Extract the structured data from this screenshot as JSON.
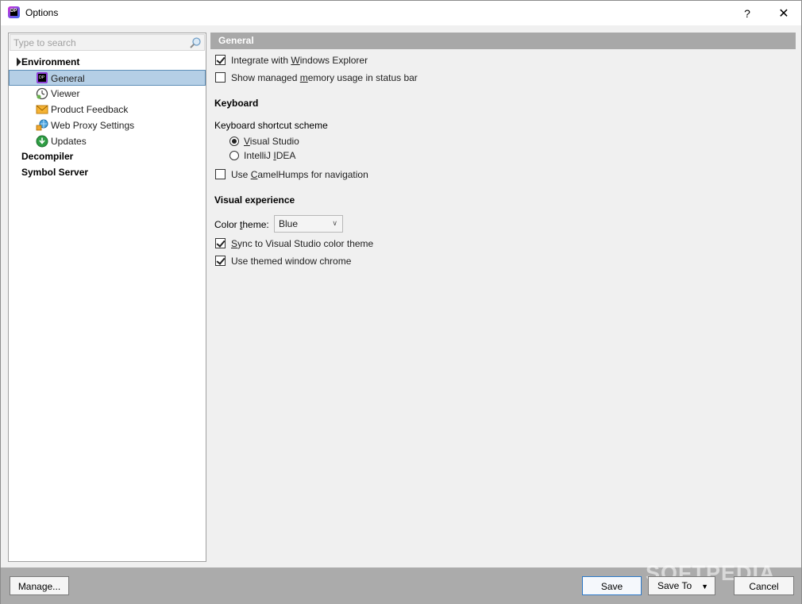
{
  "window": {
    "title": "Options",
    "help_label": "?",
    "close_label": "✕"
  },
  "app_icon_text": "DP",
  "search": {
    "placeholder": "Type to search"
  },
  "tree": {
    "environment": "Environment",
    "children": [
      "General",
      "Viewer",
      "Product Feedback",
      "Web Proxy Settings",
      "Updates"
    ],
    "decompiler": "Decompiler",
    "symbol_server": "Symbol Server",
    "selected": "General"
  },
  "general": {
    "header": "General",
    "integrate_explorer": {
      "pre": "Integrate with ",
      "accel": "W",
      "post": "indows Explorer",
      "checked": true
    },
    "show_memory": {
      "pre": "Show managed ",
      "accel": "m",
      "post": "emory usage in status bar",
      "checked": false
    },
    "keyboard_heading": "Keyboard",
    "shortcut_scheme_label": "Keyboard shortcut scheme",
    "scheme_vs": {
      "pre": "",
      "accel": "V",
      "post": "isual Studio",
      "selected": true
    },
    "scheme_idea": {
      "pre": "IntelliJ ",
      "accel": "I",
      "post": "DEA",
      "selected": false
    },
    "camelhumps": {
      "pre": "Use ",
      "accel": "C",
      "post": "amelHumps for navigation",
      "checked": false
    },
    "visual_heading": "Visual experience",
    "color_theme_label": {
      "pre": "Color ",
      "accel": "t",
      "post": "heme:"
    },
    "color_theme_value": "Blue",
    "sync_vs": {
      "pre": "",
      "accel": "S",
      "post": "ync to Visual Studio color theme",
      "checked": true
    },
    "themed_chrome": {
      "pre": "Use themed window chrome",
      "accel": "",
      "post": "",
      "checked": true
    }
  },
  "buttons": {
    "manage": "Manage...",
    "save": "Save",
    "save_to": "Save To",
    "cancel": "Cancel"
  },
  "watermark": "SOFTPEDIA",
  "colors": {
    "header_bg": "#a8a8a8",
    "selection_bg": "#b5cfe6",
    "bottom_bar": "#ababab",
    "accent": "#2b78c8"
  }
}
